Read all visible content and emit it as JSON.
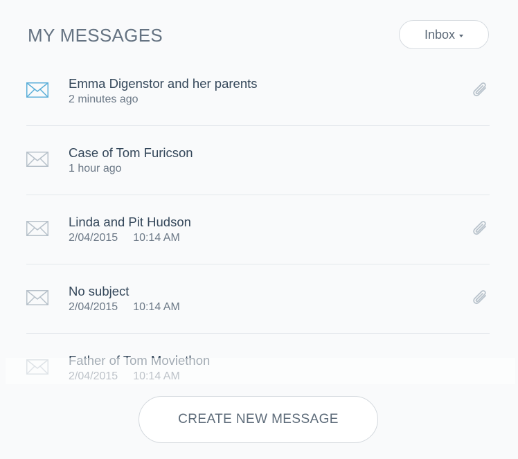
{
  "header": {
    "title": "MY MESSAGES",
    "folder_label": "Inbox"
  },
  "messages": [
    {
      "subject": "Emma Digenstor and her parents",
      "date": "2 minutes ago",
      "time": "",
      "attachment": true,
      "unread": true,
      "icon": "envelope-icon"
    },
    {
      "subject": "Case of Tom Furicson",
      "date": "1 hour ago",
      "time": "",
      "attachment": false,
      "unread": false,
      "icon": "envelope-icon"
    },
    {
      "subject": "Linda and Pit Hudson",
      "date": "2/04/2015",
      "time": "10:14 AM",
      "attachment": true,
      "unread": false,
      "icon": "envelope-icon"
    },
    {
      "subject": "No subject",
      "date": "2/04/2015",
      "time": "10:14 AM",
      "attachment": true,
      "unread": false,
      "icon": "envelope-icon"
    },
    {
      "subject": "Father of Tom Moviethon",
      "date": "2/04/2015",
      "time": "10:14 AM",
      "attachment": false,
      "unread": false,
      "icon": "envelope-icon"
    }
  ],
  "footer": {
    "create_label": "CREATE NEW MESSAGE"
  },
  "colors": {
    "unread_icon": "#5aaed8",
    "read_icon": "#b7c1ca",
    "attachment_icon": "#b9c3cc"
  }
}
